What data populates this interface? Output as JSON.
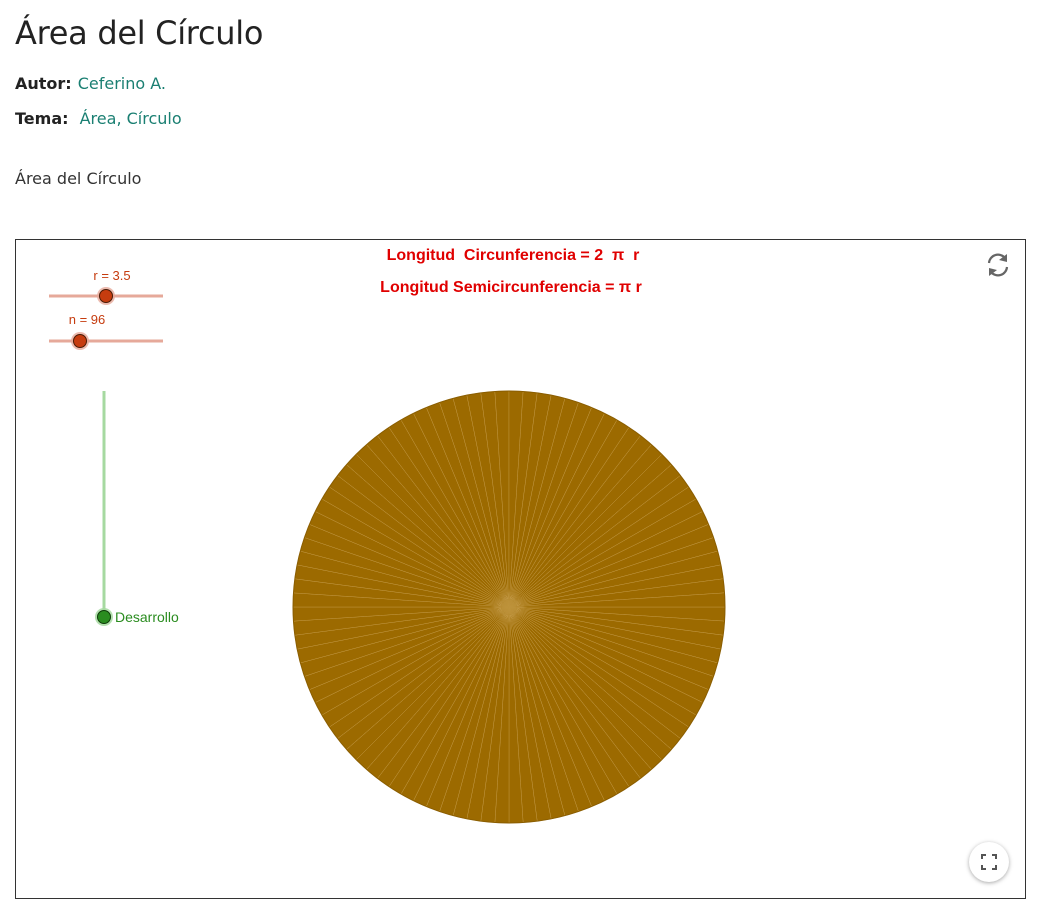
{
  "page": {
    "title": "Área del Círculo",
    "author_label": "Autor:",
    "author_name": "Ceferino A.",
    "topic_label": "Tema:",
    "topics": [
      "Área",
      "Círculo"
    ],
    "topic_separator": ",",
    "description": "Área del Círculo"
  },
  "applet": {
    "formula_circumference": "Longitud  Circunferencia = 2  π  r",
    "formula_semicircumference": "Longitud Semicircunferencia = π r",
    "slider_r": {
      "label": "r = 3.5",
      "value": 3.5
    },
    "slider_n": {
      "label": "n = 96",
      "value": 96
    },
    "development_label": "Desarrollo",
    "development_value": 0,
    "sectors": 96,
    "icons": {
      "reset": "reset-icon",
      "fullscreen": "fullscreen-icon"
    },
    "colors": {
      "formula": "#e00000",
      "slider": "#c63c0f",
      "slider_track": "#e6a99a",
      "development": "#2a8c1f",
      "development_track": "#a6d9a0",
      "circle_fill": "#9c6a00",
      "sector_line": "#c9a04e"
    }
  }
}
